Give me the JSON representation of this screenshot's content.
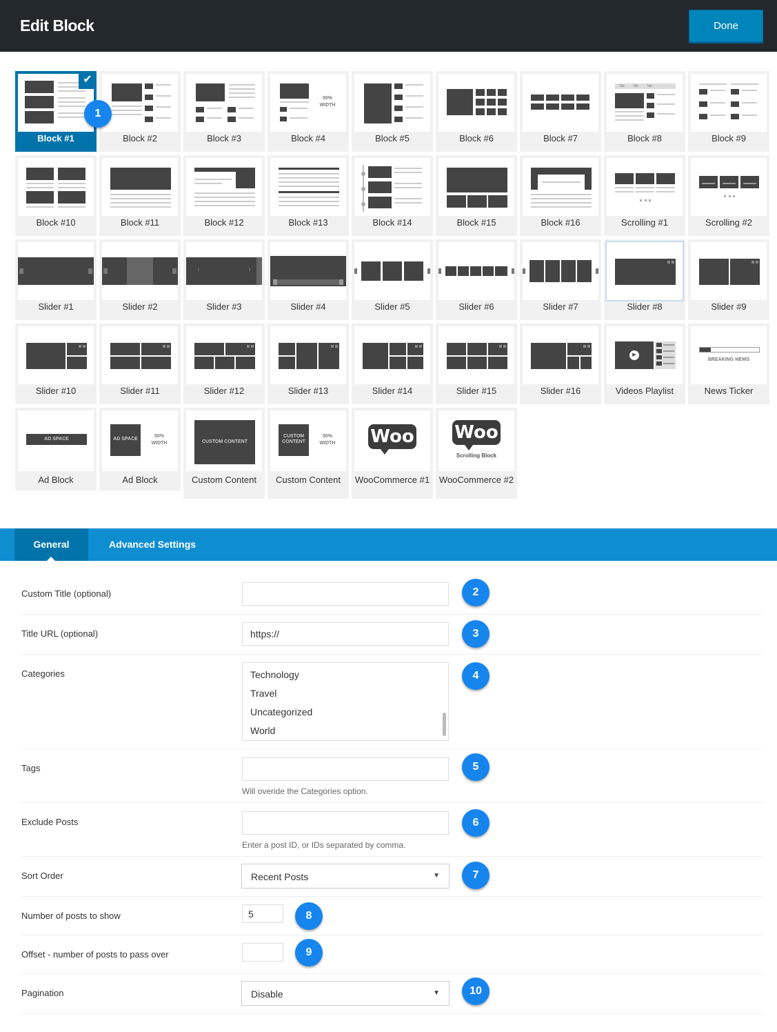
{
  "header": {
    "title": "Edit Block",
    "done_label": "Done"
  },
  "tiles": [
    "Block #1",
    "Block #2",
    "Block #3",
    "Block #4",
    "Block #5",
    "Block #6",
    "Block #7",
    "Block #8",
    "Block #9",
    "Block #10",
    "Block #11",
    "Block #12",
    "Block #13",
    "Block #14",
    "Block #15",
    "Block #16",
    "Scrolling #1",
    "Scrolling #2",
    "Slider #1",
    "Slider #2",
    "Slider #3",
    "Slider #4",
    "Slider #5",
    "Slider #6",
    "Slider #7",
    "Slider #8",
    "Slider #9",
    "Slider #10",
    "Slider #11",
    "Slider #12",
    "Slider #13",
    "Slider #14",
    "Slider #15",
    "Slider #16",
    "Videos Playlist",
    "News Ticker",
    "Ad Block",
    "Ad Block",
    "Custom Content",
    "Custom Content",
    "WooCommerce #1",
    "WooCommerce #2"
  ],
  "thumb_text": {
    "width_50_line1": "50%",
    "width_50_line2": "WIDTH",
    "breaking_news": "BREAKING NEWS",
    "ad_space": "AD SPACE",
    "custom_content": "CUSTOM CONTENT",
    "custom": "CUSTOM",
    "content": "CONTENT",
    "woo": "Woo",
    "scrolling_block": "Scrolling Block",
    "tab_labels": [
      "Tab",
      "Tab",
      "Tab"
    ]
  },
  "selected_tile": "Block #1",
  "badges": [
    "1",
    "2",
    "3",
    "4",
    "5",
    "6",
    "7",
    "8",
    "9",
    "10"
  ],
  "tabs": {
    "general": "General",
    "advanced": "Advanced Settings"
  },
  "form": {
    "custom_title": {
      "label": "Custom Title (optional)",
      "value": ""
    },
    "title_url": {
      "label": "Title URL (optional)",
      "value": "https://"
    },
    "categories": {
      "label": "Categories",
      "options": [
        "Technology",
        "Travel",
        "Uncategorized",
        "World"
      ]
    },
    "tags": {
      "label": "Tags",
      "value": "",
      "hint": "Will overide the Categories option."
    },
    "exclude_posts": {
      "label": "Exclude Posts",
      "value": "",
      "hint": "Enter a post ID, or IDs separated by comma."
    },
    "sort_order": {
      "label": "Sort Order",
      "value": "Recent Posts"
    },
    "num_posts": {
      "label": "Number of posts to show",
      "value": "5"
    },
    "offset": {
      "label": "Offset - number of posts to pass over",
      "value": ""
    },
    "pagination": {
      "label": "Pagination",
      "value": "Disable"
    }
  },
  "colors": {
    "header_bg": "#23282d",
    "primary": "#0085ba",
    "selected": "#0073aa",
    "tabbar": "#0e8ed1",
    "badge": "#1785ee"
  }
}
